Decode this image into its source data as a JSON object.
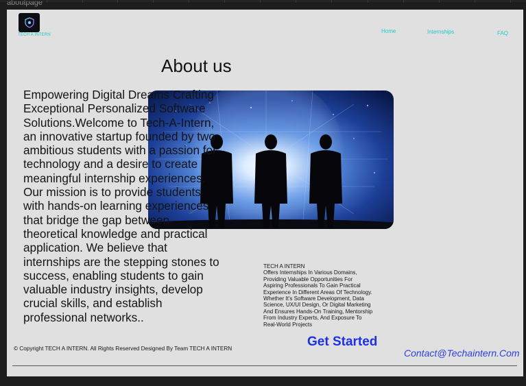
{
  "window": {
    "tab_label": "aboutpage"
  },
  "header": {
    "brand_name": "TECH A INTERN",
    "nav": {
      "home": "Home",
      "internships": "Internships",
      "faq": "FAQ"
    }
  },
  "main": {
    "title": "About us",
    "about_text": "Empowering Digital Dreams Crafting Exceptional Personalized Software Solutions.Welcome to Tech-A-Intern, an innovative startup founded by two ambitious students with a passion for technology and a desire to create meaningful internship experiences. Our mission is to provide students with hands-on learning experiences that bridge the gap between theoretical knowledge and practical application. We believe that internships are the stepping stones to success, enabling students to gain valuable industry insights, develop crucial skills, and establish professional networks..",
    "company_name": "TECH A INTERN",
    "company_description": "Offers Internships In Various Domains, Providing Valuable Opportunities For Aspiring Professionals To Gain Practical Experience In Different Areas Of Technology. Whether It's Software Development, Data Science, UX/UI Design, Or Digital Marketing And Ensures Hands-On Training, Mentorship From Industry Experts, And Exposure To Real-World Projects",
    "cta_label": "Get Started",
    "hero_image_icon": "business-silhouettes-globe-image"
  },
  "footer": {
    "copyright": "© Copyright TECH A INTERN. All Rights Reserved Designed By Team TECH A INTERN",
    "contact": "Contact@Techaintern.Com"
  },
  "colors": {
    "background": "#1e1e1e",
    "frame": "#e0e0e0",
    "nav_text": "#22c9c9",
    "cta": "#1b31e6",
    "contact": "#2a3fe0"
  }
}
